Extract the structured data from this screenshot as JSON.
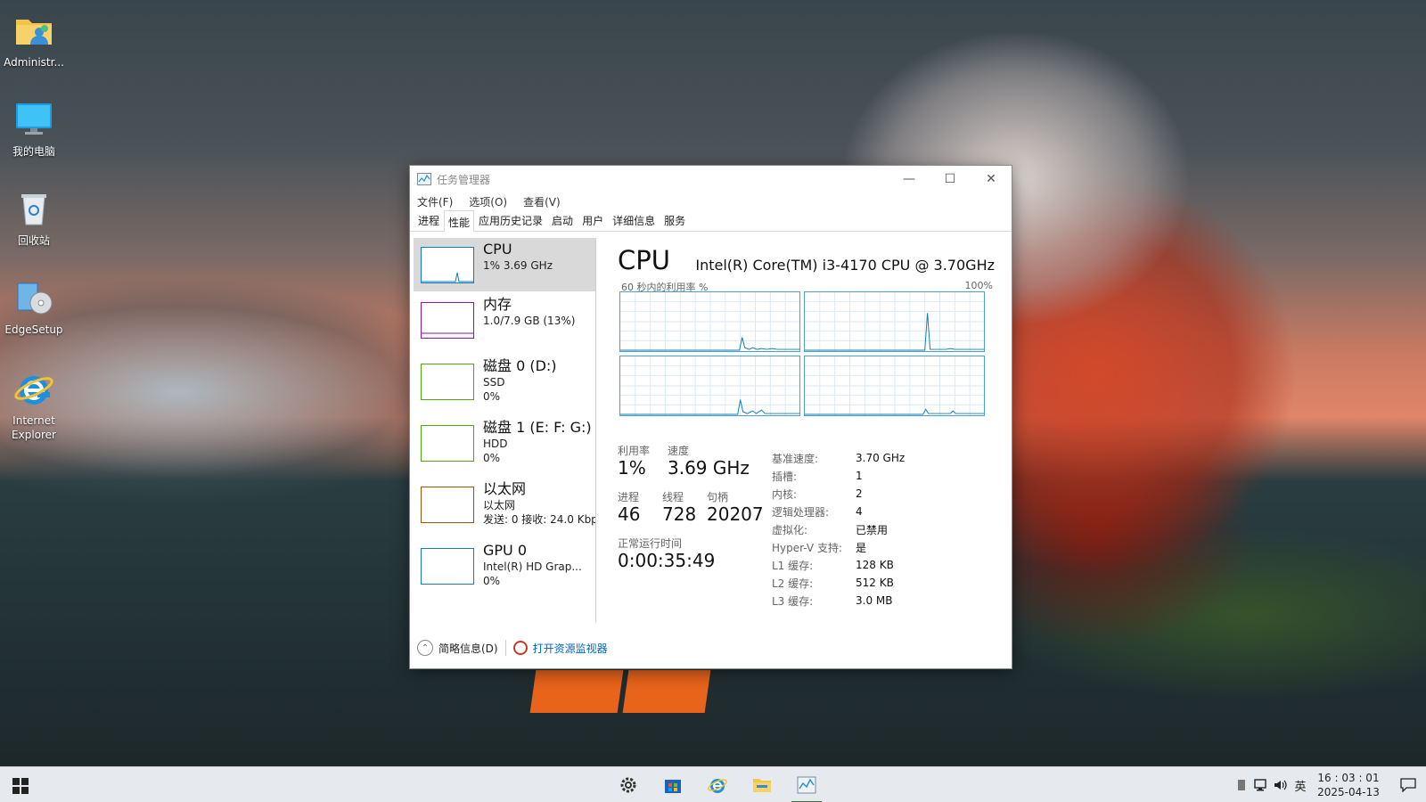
{
  "desktop": {
    "icons": [
      {
        "label": "Administr..."
      },
      {
        "label": "我的电脑"
      },
      {
        "label": "回收站"
      },
      {
        "label": "EdgeSetup"
      },
      {
        "label_line1": "Internet",
        "label_line2": "Explorer"
      }
    ]
  },
  "window": {
    "title": "任务管理器",
    "menu": [
      "文件(F)",
      "选项(O)",
      "查看(V)"
    ],
    "tabs": [
      "进程",
      "性能",
      "应用历史记录",
      "启动",
      "用户",
      "详细信息",
      "服务"
    ],
    "active_tab": "性能"
  },
  "sidebar": {
    "items": [
      {
        "name": "CPU",
        "line2": "1% 3.69 GHz",
        "line3": "",
        "color": "#117dbb"
      },
      {
        "name": "内存",
        "line2": "1.0/7.9 GB (13%)",
        "line3": "",
        "color": "#8b12ae"
      },
      {
        "name": "磁盘 0 (D:)",
        "line2": "SSD",
        "line3": "0%",
        "color": "#4da60c"
      },
      {
        "name": "磁盘 1 (E: F: G:)",
        "line2": "HDD",
        "line3": "0%",
        "color": "#4da60c"
      },
      {
        "name": "以太网",
        "line2": "以太网",
        "line3": "发送: 0 接收: 24.0 Kbp",
        "color": "#a74f01"
      },
      {
        "name": "GPU 0",
        "line2": "Intel(R) HD Grap...",
        "line3": "0%",
        "color": "#117dbb"
      }
    ]
  },
  "cpu_panel": {
    "heading": "CPU",
    "model": "Intel(R) Core(TM) i3-4170 CPU @ 3.70GHz",
    "graph_label": "60 秒内的利用率 %",
    "graph_max": "100%",
    "utilization": {
      "label": "利用率",
      "value": "1%"
    },
    "speed": {
      "label": "速度",
      "value": "3.69 GHz"
    },
    "processes": {
      "label": "进程",
      "value": "46"
    },
    "threads": {
      "label": "线程",
      "value": "728"
    },
    "handles": {
      "label": "句柄",
      "value": "20207"
    },
    "uptime": {
      "label": "正常运行时间",
      "value": "0:00:35:49"
    },
    "specs": [
      {
        "k": "基准速度:",
        "v": "3.70 GHz"
      },
      {
        "k": "插槽:",
        "v": "1"
      },
      {
        "k": "内核:",
        "v": "2"
      },
      {
        "k": "逻辑处理器:",
        "v": "4"
      },
      {
        "k": "虚拟化:",
        "v": "已禁用"
      },
      {
        "k": "Hyper-V 支持:",
        "v": "是"
      },
      {
        "k": "L1 缓存:",
        "v": "128 KB"
      },
      {
        "k": "L2 缓存:",
        "v": "512 KB"
      },
      {
        "k": "L3 缓存:",
        "v": "3.0 MB"
      }
    ]
  },
  "footer": {
    "fewer_details": "简略信息(D)",
    "resource_monitor": "打开资源监视器"
  },
  "taskbar": {
    "tray_lang": "英",
    "time": "16 : 03 : 01",
    "date": "2025-04-13"
  }
}
